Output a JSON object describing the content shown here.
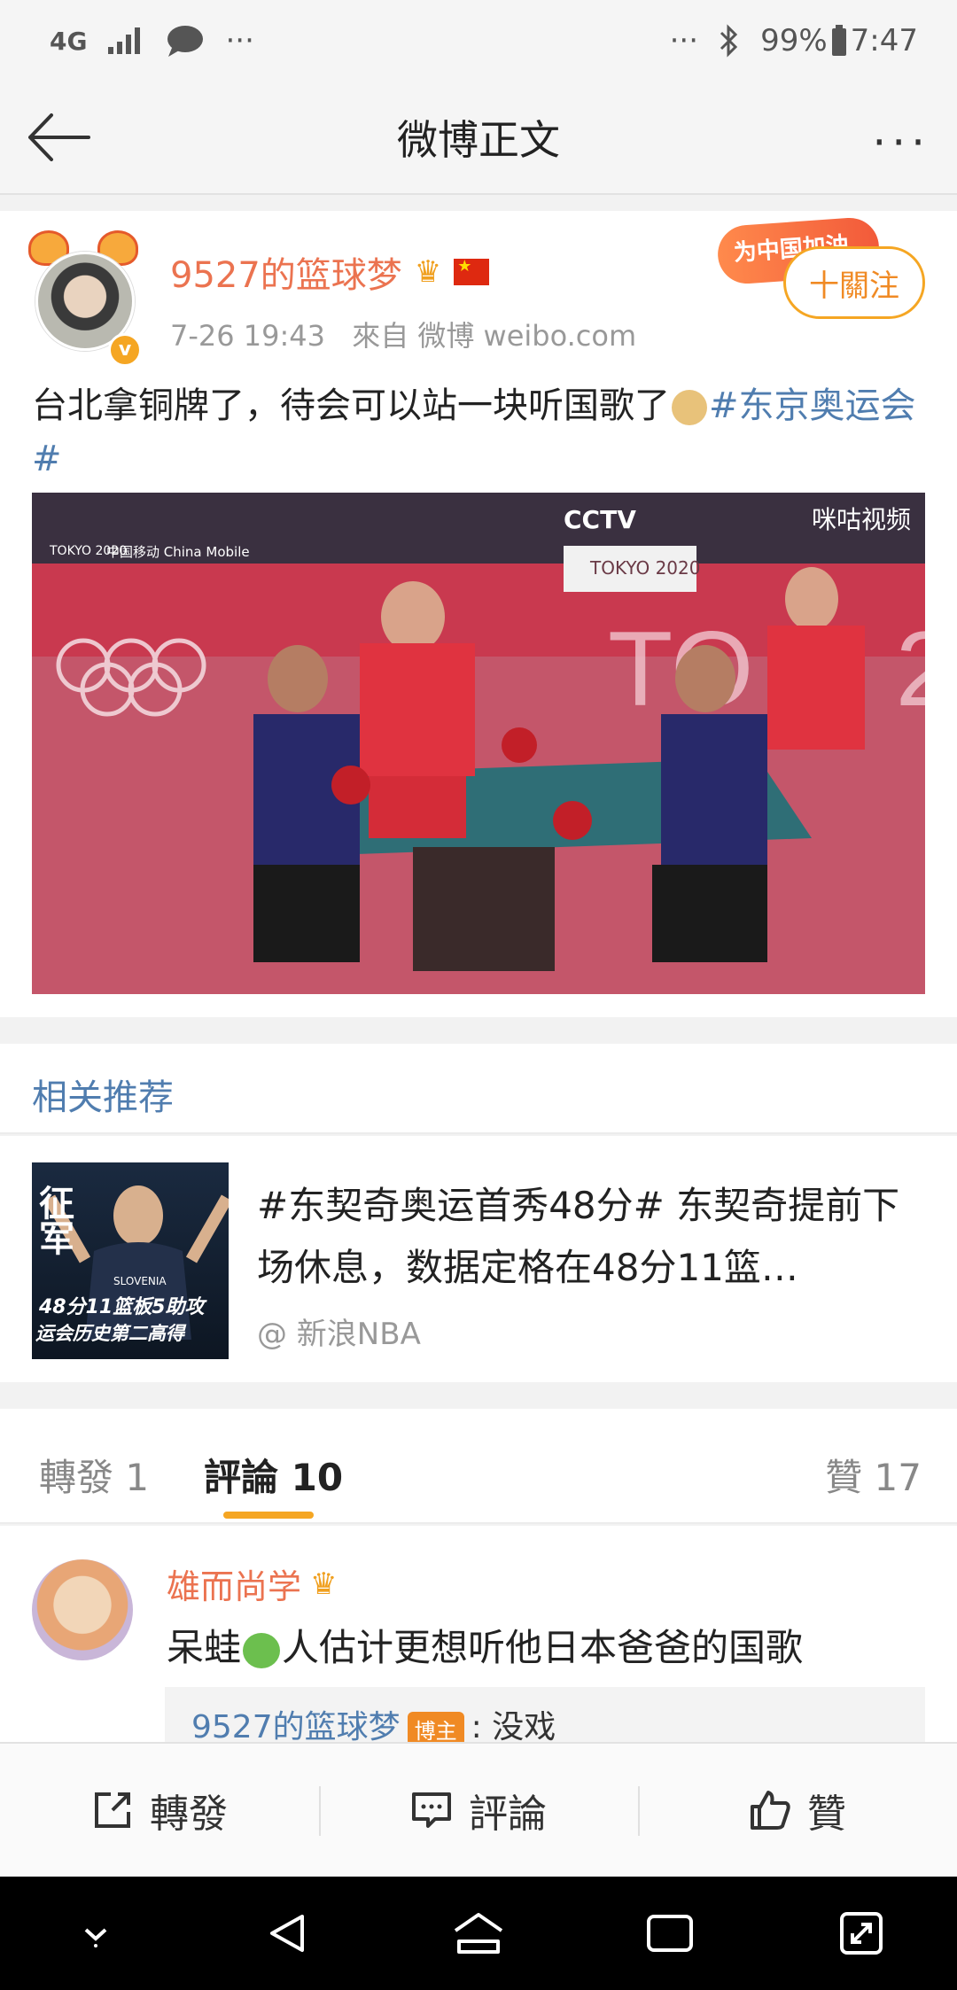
{
  "status_bar": {
    "network": "4G",
    "battery": "99%",
    "time": "7:47",
    "more": "···"
  },
  "header": {
    "title": "微博正文",
    "more": "···"
  },
  "post": {
    "username": "9527的篮球梦",
    "timestamp": "7-26 19:43",
    "source": "來自 微博 weibo.com",
    "follow_label": "十關注",
    "banner_text": "为中国加油",
    "text_plain": "台北拿铜牌了，待会可以站一块听国歌了",
    "hashtag": "#东京奥运会#",
    "image": {
      "broadcaster": "CCTV",
      "partner": "咪咕视频",
      "games": "TOKYO 2020",
      "sponsor": "中国移动 China Mobile"
    }
  },
  "recommend": {
    "section_title": "相关推荐",
    "thumb_text": "48分11篮板5助攻",
    "thumb_text2": "运会历史第二高得",
    "thumb_jersey": "SLOVENIA",
    "title": "#东契奇奥运首秀48分# 东契奇提前下场休息，数据定格在48分11篮…",
    "source": "@ 新浪NBA"
  },
  "tabs": {
    "reposts": "轉發 1",
    "comments": "評論 10",
    "likes": "贊 17"
  },
  "comment": {
    "name": "雄而尚学",
    "text_a": "呆蛙",
    "text_b": "人估计更想听他日本爸爸的国歌",
    "reply_name": "9527的篮球梦",
    "reply_badge": "博主",
    "reply_text": ": 没戏"
  },
  "action_bar": {
    "repost": "轉發",
    "comment": "評論",
    "like": "贊"
  }
}
